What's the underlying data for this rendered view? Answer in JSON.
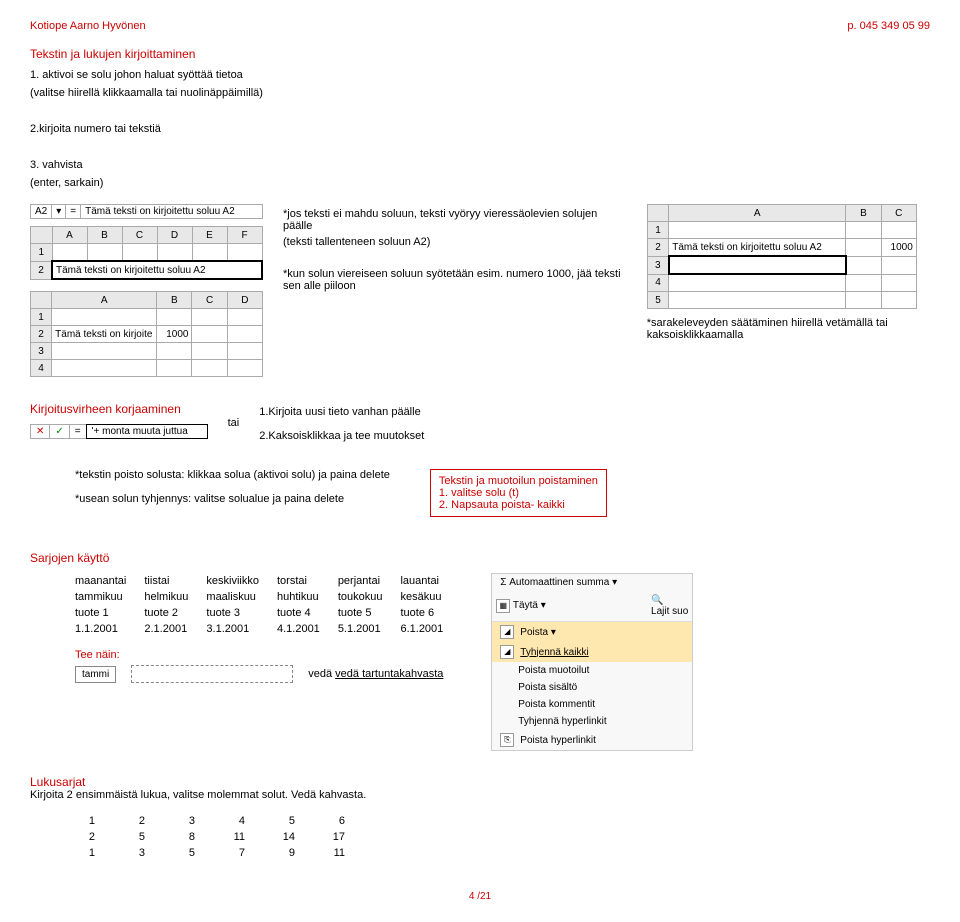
{
  "header": {
    "left": "Kotiope Aarno Hyvönen",
    "right": "p. 045 349 05 99"
  },
  "title": "Tekstin ja lukujen kirjoittaminen",
  "steps": {
    "s1a": "1. aktivoi se solu johon haluat syöttää tietoa",
    "s1b": "(valitse hiirellä klikkaamalla tai nuolinäppäimillä)",
    "s2": "2.kirjoita numero tai tekstiä",
    "s3a": "3. vahvista",
    "s3b": "(enter, sarkain)"
  },
  "fbar": {
    "cell": "A2",
    "arrow": "▾",
    "fx": "=",
    "text": "Tämä teksti on kirjoitettu soluu A2"
  },
  "tableA": {
    "headers": [
      "A",
      "B",
      "C",
      "D",
      "E",
      "F"
    ],
    "r1_hdr": "1",
    "r2_hdr": "2",
    "r2_text": "Tämä teksti on kirjoitettu soluu A2"
  },
  "tableB": {
    "headers": [
      "A",
      "B",
      "C",
      "D"
    ],
    "r1_hdr": "1",
    "r2_hdr": "2",
    "r2_a": "Tämä teksti on kirjoite",
    "r2_b": "1000",
    "r3_hdr": "3",
    "r4_hdr": "4"
  },
  "notes": {
    "n1": "*jos teksti ei mahdu soluun, teksti vyöryy vieressäolevien solujen päälle",
    "n2": "(teksti tallenteneen  soluun A2)",
    "n3": "*kun solun viereiseen soluun syötetään esim. numero 1000,  jää  teksti sen alle piiloon",
    "n4": "*sarakeleveyden säätäminen hiirellä vetämällä tai kaksoisklikkaamalla"
  },
  "tableC": {
    "headers": [
      "A",
      "B",
      "C"
    ],
    "r1": "1",
    "r2": "2",
    "r3": "3",
    "r4": "4",
    "r5": "5",
    "r2_a": "Tämä teksti on kirjoitettu soluu A2",
    "r2_c": "1000"
  },
  "correction": {
    "title": "Kirjoitusvirheen korjaaminen",
    "tai": "tai",
    "l1": "1.Kirjoita uusi tieto vanhan päälle",
    "l2": "2.Kaksoisklikkaa ja tee muutokset",
    "bar_fx1": "✕",
    "bar_fx2": "✓",
    "bar_eq": "=",
    "bar_text": "'+ monta muuta juttua"
  },
  "deletesec": {
    "l1": "*tekstin poisto solusta: klikkaa solua (aktivoi solu) ja paina delete",
    "l2": "*usean solun tyhjennys:  valitse solualue ja paina delete",
    "box1": "Tekstin ja muotoilun poistaminen",
    "box2": "1. valitse solu (t)",
    "box3": "2. Napsauta poista- kaikki"
  },
  "sarjat": {
    "title": "Sarjojen käyttö",
    "rows": [
      [
        "maanantai",
        "tiistai",
        "keskiviikko",
        "torstai",
        "perjantai",
        "lauantai"
      ],
      [
        "tammikuu",
        "helmikuu",
        "maaliskuu",
        "huhtikuu",
        "toukokuu",
        "kesäkuu"
      ],
      [
        "tuote 1",
        "tuote 2",
        "tuote 3",
        "tuote 4",
        "tuote 5",
        "tuote 6"
      ],
      [
        "1.1.2001",
        "2.1.2001",
        "3.1.2001",
        "4.1.2001",
        "5.1.2001",
        "6.1.2001"
      ]
    ]
  },
  "menu": {
    "top1": "Σ Automaattinen summa ▾",
    "top2a": "Täytä ▾",
    "top2b_icon": "🔍",
    "top2b": "Lajit suo",
    "top3": "Poista ▾",
    "i1": "Tyhjennä kaikki",
    "i2": "Poista muotoilut",
    "i3": "Poista sisältö",
    "i4": "Poista kommentit",
    "i5": "Tyhjennä hyperlinkit",
    "i6": "Poista hyperlinkit"
  },
  "tee": {
    "title": "Tee näin:",
    "cell": "tammi",
    "veda": "vedä tartuntakahvasta"
  },
  "luku": {
    "title": "Lukusarjat",
    "desc": "Kirjoita 2 ensimmäistä lukua, valitse molemmat solut. Vedä kahvasta.",
    "rows": [
      [
        "1",
        "2",
        "3",
        "4",
        "5",
        "6"
      ],
      [
        "2",
        "5",
        "8",
        "11",
        "14",
        "17"
      ],
      [
        "1",
        "3",
        "5",
        "7",
        "9",
        "11"
      ]
    ]
  },
  "pagenum": "4 /21"
}
